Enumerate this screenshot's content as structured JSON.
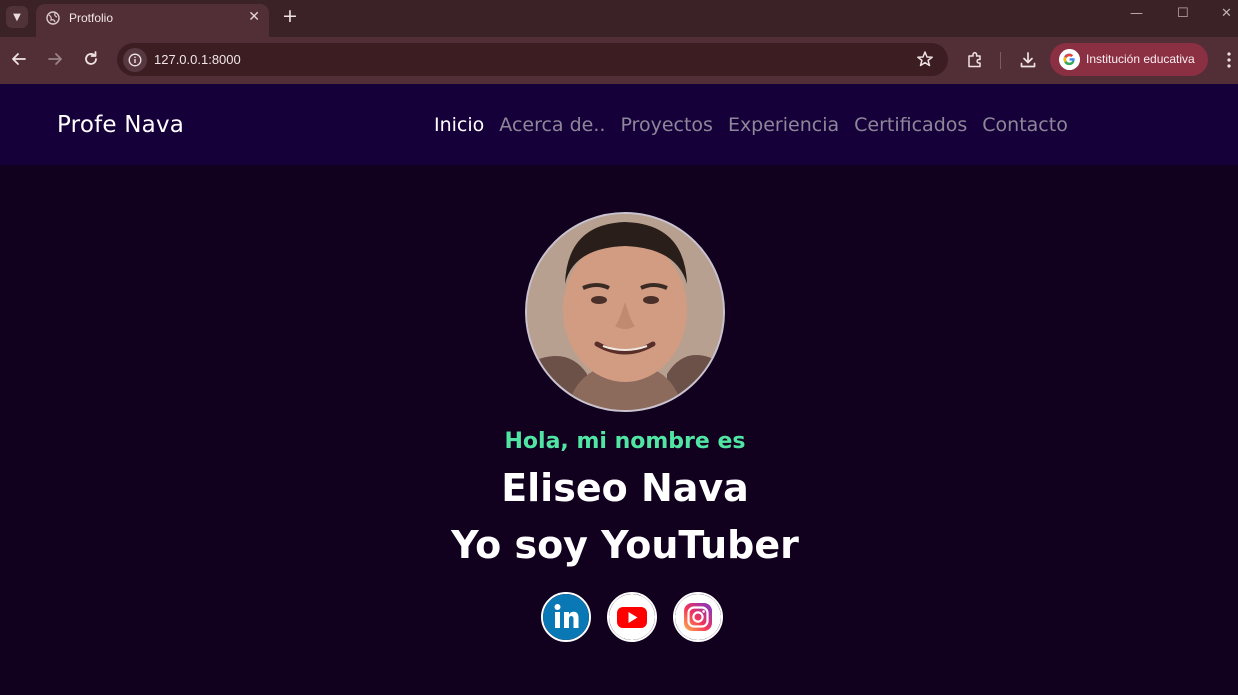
{
  "browser": {
    "tab_title": "Protfolio",
    "url": "127.0.0.1:8000",
    "profile_label": "Institución educativa"
  },
  "site": {
    "brand": "Profe Nava",
    "nav": [
      "Inicio",
      "Acerca de..",
      "Proyectos",
      "Experiencia",
      "Certificados",
      "Contacto"
    ],
    "active_nav": "Inicio"
  },
  "hero": {
    "greeting": "Hola, mi nombre es",
    "name": "Eliseo Nava",
    "role": "Yo soy YouTuber",
    "socials": [
      "linkedin-icon",
      "youtube-icon",
      "instagram-icon"
    ]
  },
  "colors": {
    "page_bg": "#12001f",
    "nav_bg": "#160039",
    "greeting": "#51e5a3",
    "nav_inactive": "#8d8799"
  }
}
